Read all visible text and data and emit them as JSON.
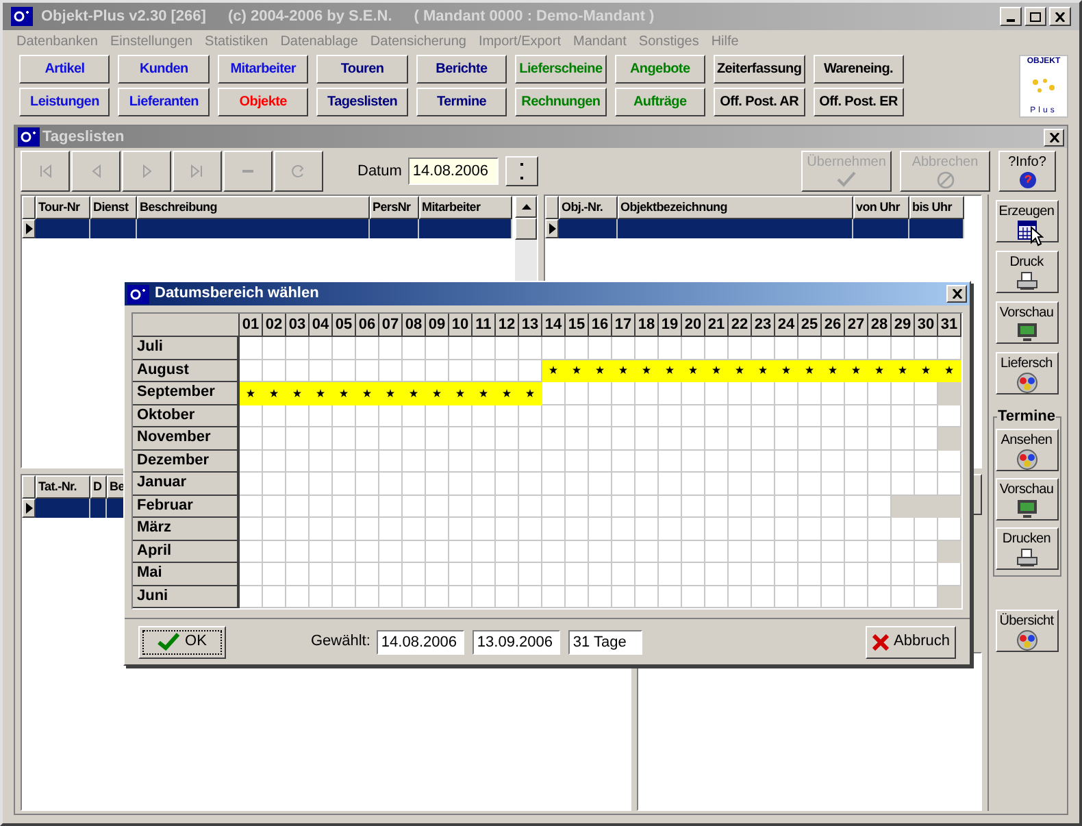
{
  "window": {
    "title": "Objekt-Plus  v2.30 [266]",
    "copyright": "(c) 2004-2006 by S.E.N.",
    "mandant": "( Mandant 0000 : Demo-Mandant )"
  },
  "menu": [
    "Datenbanken",
    "Einstellungen",
    "Statistiken",
    "Datenablage",
    "Datensicherung",
    "Import/Export",
    "Mandant",
    "Sonstiges",
    "Hilfe"
  ],
  "toolbar": [
    {
      "label": "Artikel",
      "color": "#1010e0"
    },
    {
      "label": "Kunden",
      "color": "#1010e0"
    },
    {
      "label": "Mitarbeiter",
      "color": "#1010e0"
    },
    {
      "label": "Touren",
      "color": "#000080"
    },
    {
      "label": "Berichte",
      "color": "#000080"
    },
    {
      "label": "Lieferscheine",
      "color": "#008000"
    },
    {
      "label": "Angebote",
      "color": "#008000"
    },
    {
      "label": "Zeiterfassung",
      "color": "#000000"
    },
    {
      "label": "Wareneing.",
      "color": "#000000"
    },
    {
      "label": "Leistungen",
      "color": "#1010e0"
    },
    {
      "label": "Lieferanten",
      "color": "#1010e0"
    },
    {
      "label": "Objekte",
      "color": "#ff0000"
    },
    {
      "label": "Tageslisten",
      "color": "#000080"
    },
    {
      "label": "Termine",
      "color": "#000080"
    },
    {
      "label": "Rechnungen",
      "color": "#008000"
    },
    {
      "label": "Aufträge",
      "color": "#008000"
    },
    {
      "label": "Off. Post. AR",
      "color": "#000000"
    },
    {
      "label": "Off. Post. ER",
      "color": "#000000"
    }
  ],
  "logo": {
    "title": "OBJEKT",
    "subtitle": "Plus"
  },
  "child_window": {
    "title": "Tageslisten"
  },
  "nav": [
    {
      "kind": "first",
      "disabled": true
    },
    {
      "kind": "prev",
      "disabled": true
    },
    {
      "kind": "next",
      "disabled": true
    },
    {
      "kind": "last",
      "disabled": true
    },
    {
      "kind": "minus",
      "disabled": true
    },
    {
      "kind": "refresh",
      "disabled": true
    }
  ],
  "date": {
    "label": "Datum",
    "value": "14.08.2006"
  },
  "actions": [
    {
      "kind": "accept",
      "label": "Übernehmen",
      "disabled": true
    },
    {
      "kind": "cancel",
      "label": "Abbrechen",
      "disabled": true
    },
    {
      "kind": "info",
      "label": "?Info?",
      "disabled": false
    }
  ],
  "tours_table": {
    "columns": [
      "Tour-Nr",
      "Dienst",
      "Beschreibung",
      "PersNr",
      "Mitarbeiter"
    ],
    "rows": [
      {
        "selected": true
      }
    ]
  },
  "objects_table": {
    "columns": [
      "Obj.-Nr.",
      "Objektbezeichnung",
      "von Uhr",
      "bis Uhr"
    ],
    "rows": [
      {
        "selected": true
      }
    ]
  },
  "tasks_table": {
    "columns": [
      "Tat.-Nr.",
      "D",
      "Be"
    ],
    "rows": [
      {
        "selected": true
      }
    ]
  },
  "sidebar": {
    "buttons": [
      {
        "kind": "calendar",
        "label": "Erzeugen"
      },
      {
        "kind": "printer",
        "label": "Druck"
      },
      {
        "kind": "monitor",
        "label": "Vorschau"
      },
      {
        "kind": "people",
        "label": "Liefersch"
      }
    ],
    "group": {
      "title": "Termine",
      "buttons": [
        {
          "kind": "people",
          "label": "Ansehen"
        },
        {
          "kind": "monitor",
          "label": "Vorschau"
        },
        {
          "kind": "printer",
          "label": "Drucken"
        }
      ]
    },
    "bottom_buttons": [
      {
        "kind": "people",
        "label": "Übersicht"
      }
    ]
  },
  "dialog": {
    "title": "Datumsbereich wählen",
    "days": [
      "01",
      "02",
      "03",
      "04",
      "05",
      "06",
      "07",
      "08",
      "09",
      "10",
      "11",
      "12",
      "13",
      "14",
      "15",
      "16",
      "17",
      "18",
      "19",
      "20",
      "21",
      "22",
      "23",
      "24",
      "25",
      "26",
      "27",
      "28",
      "29",
      "30",
      "31"
    ],
    "months": [
      {
        "name": "Juli",
        "selected": [
          false,
          false,
          false,
          false,
          false,
          false,
          false,
          false,
          false,
          false,
          false,
          false,
          false,
          false,
          false,
          false,
          false,
          false,
          false,
          false,
          false,
          false,
          false,
          false,
          false,
          false,
          false,
          false,
          false,
          false,
          false
        ],
        "disabled": [
          false,
          false,
          false,
          false,
          false,
          false,
          false,
          false,
          false,
          false,
          false,
          false,
          false,
          false,
          false,
          false,
          false,
          false,
          false,
          false,
          false,
          false,
          false,
          false,
          false,
          false,
          false,
          false,
          false,
          false,
          false
        ]
      },
      {
        "name": "August",
        "selected": [
          false,
          false,
          false,
          false,
          false,
          false,
          false,
          false,
          false,
          false,
          false,
          false,
          false,
          true,
          true,
          true,
          true,
          true,
          true,
          true,
          true,
          true,
          true,
          true,
          true,
          true,
          true,
          true,
          true,
          true,
          true
        ],
        "disabled": [
          false,
          false,
          false,
          false,
          false,
          false,
          false,
          false,
          false,
          false,
          false,
          false,
          false,
          false,
          false,
          false,
          false,
          false,
          false,
          false,
          false,
          false,
          false,
          false,
          false,
          false,
          false,
          false,
          false,
          false,
          false
        ]
      },
      {
        "name": "September",
        "selected": [
          true,
          true,
          true,
          true,
          true,
          true,
          true,
          true,
          true,
          true,
          true,
          true,
          true,
          false,
          false,
          false,
          false,
          false,
          false,
          false,
          false,
          false,
          false,
          false,
          false,
          false,
          false,
          false,
          false,
          false,
          false
        ],
        "disabled": [
          false,
          false,
          false,
          false,
          false,
          false,
          false,
          false,
          false,
          false,
          false,
          false,
          false,
          false,
          false,
          false,
          false,
          false,
          false,
          false,
          false,
          false,
          false,
          false,
          false,
          false,
          false,
          false,
          false,
          false,
          true
        ]
      },
      {
        "name": "Oktober",
        "selected": [
          false,
          false,
          false,
          false,
          false,
          false,
          false,
          false,
          false,
          false,
          false,
          false,
          false,
          false,
          false,
          false,
          false,
          false,
          false,
          false,
          false,
          false,
          false,
          false,
          false,
          false,
          false,
          false,
          false,
          false,
          false
        ],
        "disabled": [
          false,
          false,
          false,
          false,
          false,
          false,
          false,
          false,
          false,
          false,
          false,
          false,
          false,
          false,
          false,
          false,
          false,
          false,
          false,
          false,
          false,
          false,
          false,
          false,
          false,
          false,
          false,
          false,
          false,
          false,
          false
        ]
      },
      {
        "name": "November",
        "selected": [
          false,
          false,
          false,
          false,
          false,
          false,
          false,
          false,
          false,
          false,
          false,
          false,
          false,
          false,
          false,
          false,
          false,
          false,
          false,
          false,
          false,
          false,
          false,
          false,
          false,
          false,
          false,
          false,
          false,
          false,
          false
        ],
        "disabled": [
          false,
          false,
          false,
          false,
          false,
          false,
          false,
          false,
          false,
          false,
          false,
          false,
          false,
          false,
          false,
          false,
          false,
          false,
          false,
          false,
          false,
          false,
          false,
          false,
          false,
          false,
          false,
          false,
          false,
          false,
          true
        ]
      },
      {
        "name": "Dezember",
        "selected": [
          false,
          false,
          false,
          false,
          false,
          false,
          false,
          false,
          false,
          false,
          false,
          false,
          false,
          false,
          false,
          false,
          false,
          false,
          false,
          false,
          false,
          false,
          false,
          false,
          false,
          false,
          false,
          false,
          false,
          false,
          false
        ],
        "disabled": [
          false,
          false,
          false,
          false,
          false,
          false,
          false,
          false,
          false,
          false,
          false,
          false,
          false,
          false,
          false,
          false,
          false,
          false,
          false,
          false,
          false,
          false,
          false,
          false,
          false,
          false,
          false,
          false,
          false,
          false,
          false
        ]
      },
      {
        "name": "Januar",
        "selected": [
          false,
          false,
          false,
          false,
          false,
          false,
          false,
          false,
          false,
          false,
          false,
          false,
          false,
          false,
          false,
          false,
          false,
          false,
          false,
          false,
          false,
          false,
          false,
          false,
          false,
          false,
          false,
          false,
          false,
          false,
          false
        ],
        "disabled": [
          false,
          false,
          false,
          false,
          false,
          false,
          false,
          false,
          false,
          false,
          false,
          false,
          false,
          false,
          false,
          false,
          false,
          false,
          false,
          false,
          false,
          false,
          false,
          false,
          false,
          false,
          false,
          false,
          false,
          false,
          false
        ]
      },
      {
        "name": "Februar",
        "selected": [
          false,
          false,
          false,
          false,
          false,
          false,
          false,
          false,
          false,
          false,
          false,
          false,
          false,
          false,
          false,
          false,
          false,
          false,
          false,
          false,
          false,
          false,
          false,
          false,
          false,
          false,
          false,
          false,
          false,
          false,
          false
        ],
        "disabled": [
          false,
          false,
          false,
          false,
          false,
          false,
          false,
          false,
          false,
          false,
          false,
          false,
          false,
          false,
          false,
          false,
          false,
          false,
          false,
          false,
          false,
          false,
          false,
          false,
          false,
          false,
          false,
          false,
          true,
          true,
          true
        ]
      },
      {
        "name": "März",
        "selected": [
          false,
          false,
          false,
          false,
          false,
          false,
          false,
          false,
          false,
          false,
          false,
          false,
          false,
          false,
          false,
          false,
          false,
          false,
          false,
          false,
          false,
          false,
          false,
          false,
          false,
          false,
          false,
          false,
          false,
          false,
          false
        ],
        "disabled": [
          false,
          false,
          false,
          false,
          false,
          false,
          false,
          false,
          false,
          false,
          false,
          false,
          false,
          false,
          false,
          false,
          false,
          false,
          false,
          false,
          false,
          false,
          false,
          false,
          false,
          false,
          false,
          false,
          false,
          false,
          false
        ]
      },
      {
        "name": "April",
        "selected": [
          false,
          false,
          false,
          false,
          false,
          false,
          false,
          false,
          false,
          false,
          false,
          false,
          false,
          false,
          false,
          false,
          false,
          false,
          false,
          false,
          false,
          false,
          false,
          false,
          false,
          false,
          false,
          false,
          false,
          false,
          false
        ],
        "disabled": [
          false,
          false,
          false,
          false,
          false,
          false,
          false,
          false,
          false,
          false,
          false,
          false,
          false,
          false,
          false,
          false,
          false,
          false,
          false,
          false,
          false,
          false,
          false,
          false,
          false,
          false,
          false,
          false,
          false,
          false,
          true
        ]
      },
      {
        "name": "Mai",
        "selected": [
          false,
          false,
          false,
          false,
          false,
          false,
          false,
          false,
          false,
          false,
          false,
          false,
          false,
          false,
          false,
          false,
          false,
          false,
          false,
          false,
          false,
          false,
          false,
          false,
          false,
          false,
          false,
          false,
          false,
          false,
          false
        ],
        "disabled": [
          false,
          false,
          false,
          false,
          false,
          false,
          false,
          false,
          false,
          false,
          false,
          false,
          false,
          false,
          false,
          false,
          false,
          false,
          false,
          false,
          false,
          false,
          false,
          false,
          false,
          false,
          false,
          false,
          false,
          false,
          false
        ]
      },
      {
        "name": "Juni",
        "selected": [
          false,
          false,
          false,
          false,
          false,
          false,
          false,
          false,
          false,
          false,
          false,
          false,
          false,
          false,
          false,
          false,
          false,
          false,
          false,
          false,
          false,
          false,
          false,
          false,
          false,
          false,
          false,
          false,
          false,
          false,
          false
        ],
        "disabled": [
          false,
          false,
          false,
          false,
          false,
          false,
          false,
          false,
          false,
          false,
          false,
          false,
          false,
          false,
          false,
          false,
          false,
          false,
          false,
          false,
          false,
          false,
          false,
          false,
          false,
          false,
          false,
          false,
          false,
          false,
          true
        ]
      }
    ],
    "ok": "OK",
    "chosen_label": "Gewählt:",
    "from": "14.08.2006",
    "to": "13.09.2006",
    "duration": "31 Tage",
    "cancel": "Abbruch"
  }
}
